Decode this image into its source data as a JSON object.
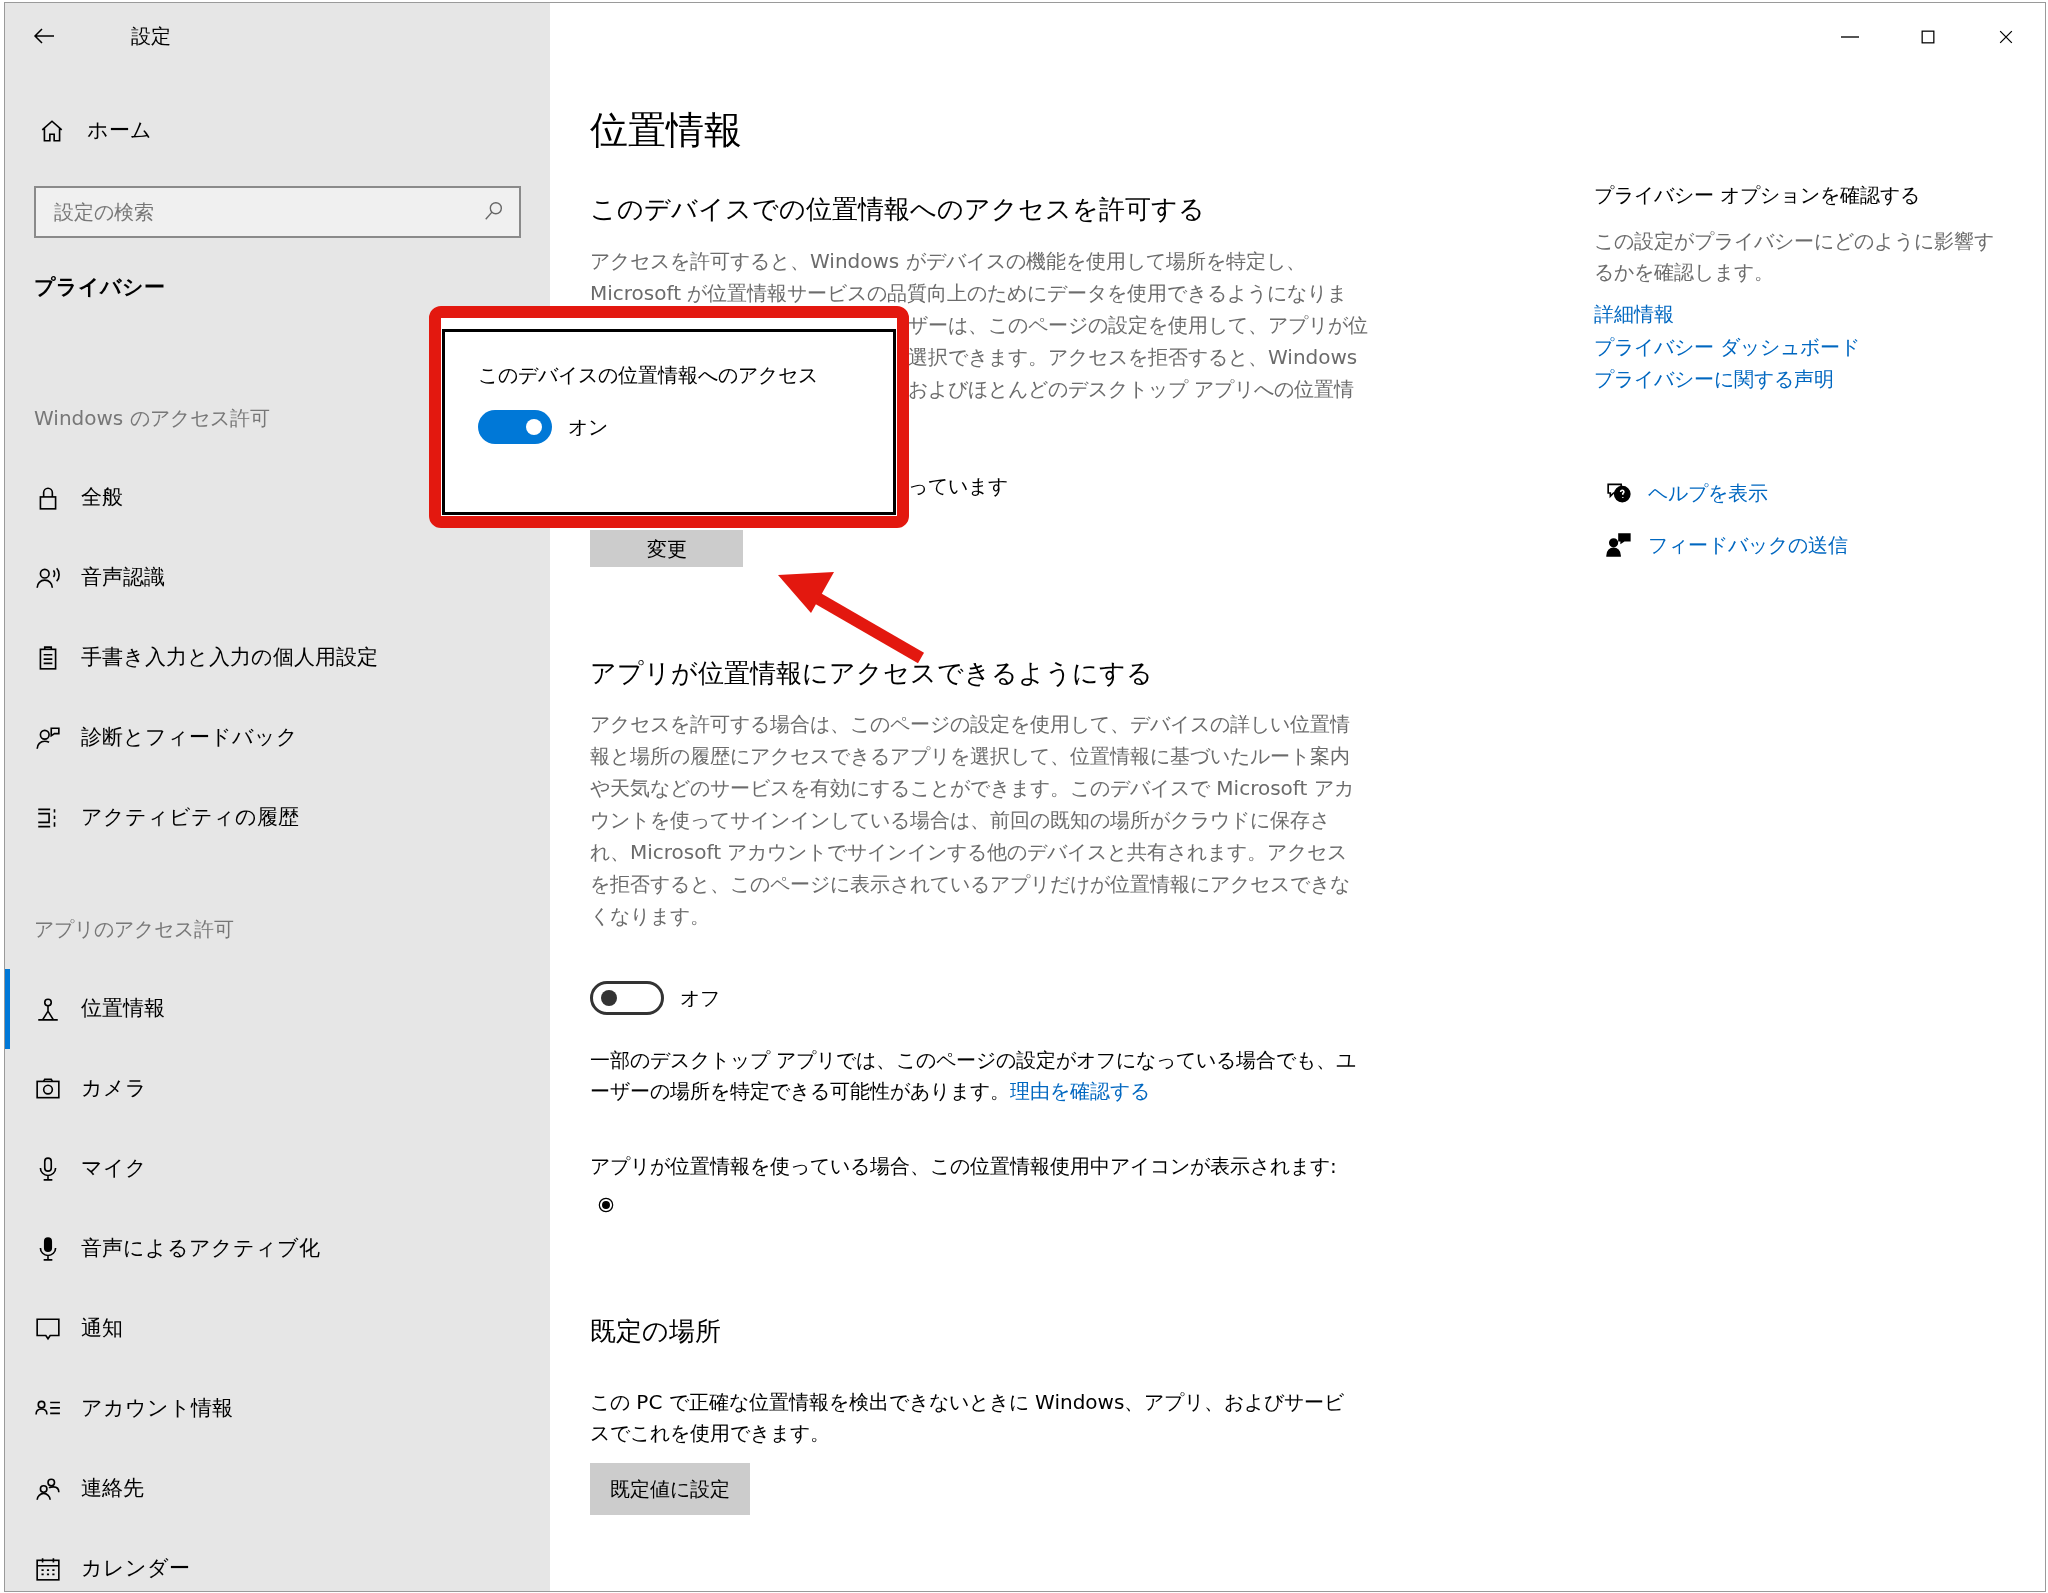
{
  "window": {
    "title": "設定"
  },
  "sidebar": {
    "home": "ホーム",
    "search": {
      "placeholder": "設定の検索"
    },
    "section": "プライバシー",
    "groups": [
      {
        "header": "Windows のアクセス許可",
        "items": [
          {
            "label": "全般",
            "selected": false
          },
          {
            "label": "音声認識",
            "selected": false
          },
          {
            "label": "手書き入力と入力の個人用設定",
            "selected": false
          },
          {
            "label": "診断とフィードバック",
            "selected": false
          },
          {
            "label": "アクティビティの履歴",
            "selected": false
          }
        ]
      },
      {
        "header": "アプリのアクセス許可",
        "items": [
          {
            "label": "位置情報",
            "selected": true
          },
          {
            "label": "カメラ",
            "selected": false
          },
          {
            "label": "マイク",
            "selected": false
          },
          {
            "label": "音声によるアクティブ化",
            "selected": false
          },
          {
            "label": "通知",
            "selected": false
          },
          {
            "label": "アカウント情報",
            "selected": false
          },
          {
            "label": "連絡先",
            "selected": false
          },
          {
            "label": "カレンダー",
            "selected": false
          }
        ]
      }
    ]
  },
  "page": {
    "title": "位置情報",
    "device_access": {
      "heading": "このデバイスでの位置情報へのアクセスを許可する",
      "description_lines": [
        {
          "kind": "full",
          "text": "アクセスを許可すると、Windows がデバイスの機能を使用して場所を特定し、"
        },
        {
          "kind": "full",
          "text": "Microsoft が位置情報サービスの品質向上のためにデータを使用できるようになりま"
        },
        {
          "kind": "cut",
          "text": "ザーは、このページの設定を使用して、アプリが位"
        },
        {
          "kind": "cut",
          "text": "選択できます。アクセスを拒否すると、Windows"
        },
        {
          "kind": "cut",
          "text": "およびほとんどのデスクトップ アプリへの位置情"
        }
      ],
      "status_fragment": "っています",
      "button": "変更"
    },
    "app_access": {
      "heading": "アプリが位置情報にアクセスできるようにする",
      "description": "アクセスを許可する場合は、このページの設定を使用して、デバイスの詳しい位置情報と場所の履歴にアクセスできるアプリを選択して、位置情報に基づいたルート案内や天気などのサービスを有効にすることができます。このデバイスで Microsoft アカウントを使ってサインインしている場合は、前回の既知の場所がクラウドに保存され、Microsoft アカウントでサインインする他のデバイスと共有されます。アクセスを拒否すると、このページに表示されているアプリだけが位置情報にアクセスできなくなります。",
      "toggle": {
        "on": false,
        "label": "オフ"
      },
      "note": {
        "text": "一部のデスクトップ アプリでは、このページの設定がオフになっている場合でも、ユーザーの場所を特定できる可能性があります。",
        "link": "理由を確認する"
      },
      "indicator_note": "アプリが位置情報を使っている場合、この位置情報使用中アイコンが表示されます:"
    },
    "default_location": {
      "heading": "既定の場所",
      "description": "この PC で正確な位置情報を検出できないときに Windows、アプリ、およびサービスでこれを使用できます。",
      "button": "既定値に設定"
    }
  },
  "popup": {
    "title": "このデバイスの位置情報へのアクセス",
    "toggle": {
      "on": true,
      "label": "オン"
    }
  },
  "related": {
    "heading": "プライバシー オプションを確認する",
    "description": "この設定がプライバシーにどのように影響するかを確認します。",
    "links": [
      "詳細情報",
      "プライバシー ダッシュボード",
      "プライバシーに関する声明"
    ],
    "support": [
      "ヘルプを表示",
      "フィードバックの送信"
    ]
  }
}
